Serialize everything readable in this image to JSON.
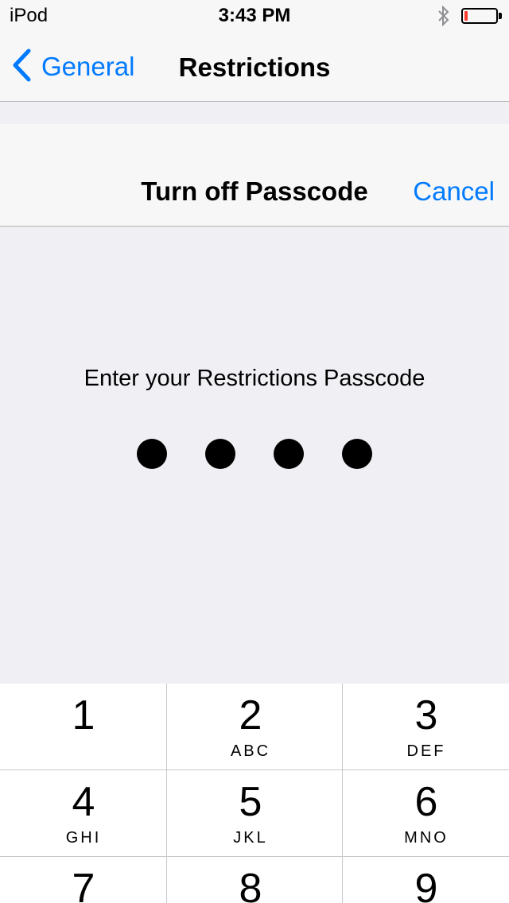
{
  "status_bar": {
    "device": "iPod",
    "time": "3:43 PM",
    "battery_level": 0.1,
    "battery_color": "#ff3b30",
    "bluetooth_icon": "bluetooth-icon"
  },
  "nav": {
    "back_label": "General",
    "back_icon": "chevron-left-icon",
    "title": "Restrictions"
  },
  "sheet": {
    "title": "Turn off Passcode",
    "cancel_label": "Cancel",
    "prompt": "Enter your Restrictions Passcode",
    "entered_digits": 4
  },
  "keypad": {
    "keys": [
      {
        "digit": "1",
        "letters": ""
      },
      {
        "digit": "2",
        "letters": "ABC"
      },
      {
        "digit": "3",
        "letters": "DEF"
      },
      {
        "digit": "4",
        "letters": "GHI"
      },
      {
        "digit": "5",
        "letters": "JKL"
      },
      {
        "digit": "6",
        "letters": "MNO"
      },
      {
        "digit": "7",
        "letters": ""
      },
      {
        "digit": "8",
        "letters": ""
      },
      {
        "digit": "9",
        "letters": ""
      }
    ]
  },
  "colors": {
    "accent": "#007aff",
    "background": "#efeff4",
    "bar": "#f7f7f7"
  }
}
